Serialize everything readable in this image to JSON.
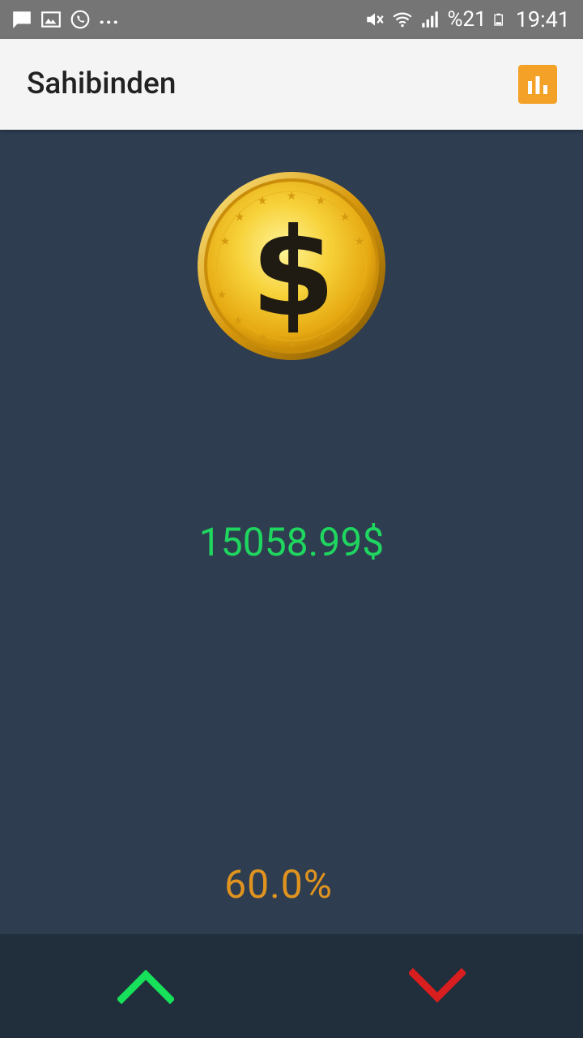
{
  "status_bar": {
    "notification_icons": [
      "message-icon",
      "gallery-icon",
      "whatsapp-icon"
    ],
    "overflow": "...",
    "right_icons": [
      "mute-icon",
      "wifi-icon",
      "signal-icon"
    ],
    "battery_text": "%21",
    "time": "19:41"
  },
  "app_bar": {
    "title": "Sahibinden",
    "action_icon": "bar-chart-icon"
  },
  "main": {
    "coin_icon": "dollar-coin-icon",
    "price": "15058.99$",
    "percent": "60.0%"
  },
  "bottom_bar": {
    "up_icon": "chevron-up-icon",
    "down_icon": "chevron-down-icon"
  },
  "colors": {
    "background": "#2e3d50",
    "bottom_bar": "#212e3c",
    "price_green": "#1fd65f",
    "percent_orange": "#e0941f",
    "accent_orange": "#f4a128",
    "up_green": "#17e05a",
    "down_red": "#d81e1e"
  }
}
